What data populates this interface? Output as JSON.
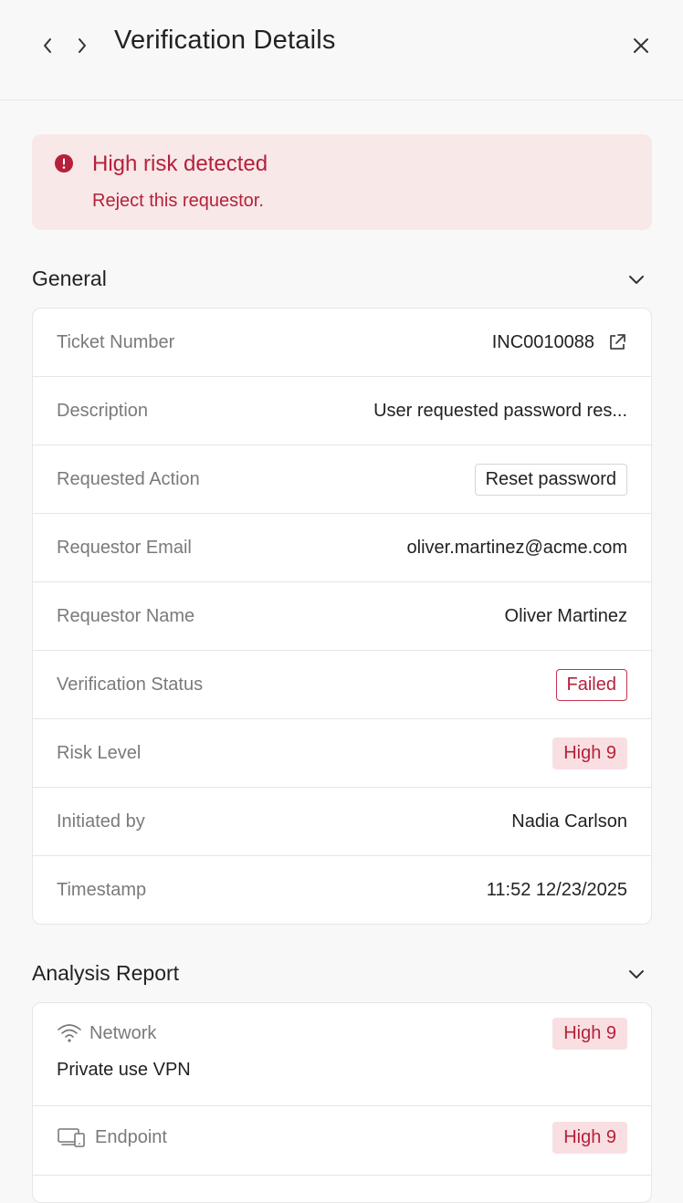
{
  "header": {
    "title": "Verification Details"
  },
  "alert": {
    "title": "High risk detected",
    "message": "Reject this requestor."
  },
  "general": {
    "title": "General",
    "rows": [
      {
        "label": "Ticket Number",
        "value": "INC0010088"
      },
      {
        "label": "Description",
        "value": "User requested password res..."
      },
      {
        "label": "Requested Action",
        "value": "Reset password"
      },
      {
        "label": "Requestor Email",
        "value": "oliver.martinez@acme.com"
      },
      {
        "label": "Requestor Name",
        "value": "Oliver Martinez"
      },
      {
        "label": "Verification Status",
        "value": "Failed"
      },
      {
        "label": "Risk Level",
        "value": "High 9"
      },
      {
        "label": "Initiated by",
        "value": "Nadia Carlson"
      },
      {
        "label": "Timestamp",
        "value": "11:52 12/23/2025"
      }
    ]
  },
  "analysis": {
    "title": "Analysis Report",
    "items": [
      {
        "label": "Network",
        "icon": "wifi-icon",
        "risk": "High 9",
        "detail": "Private use VPN"
      },
      {
        "label": "Endpoint",
        "icon": "devices-icon",
        "risk": "High 9"
      }
    ]
  },
  "colors": {
    "danger": "#b5213b",
    "danger_bg": "#f8e8e8",
    "pill_bg": "#f9dfe2"
  }
}
